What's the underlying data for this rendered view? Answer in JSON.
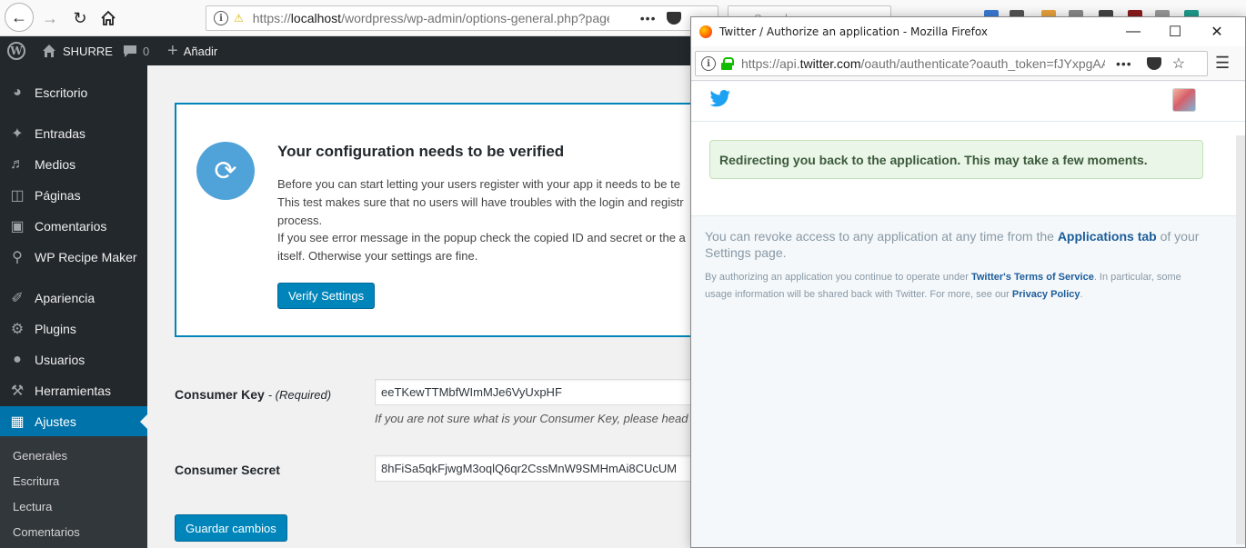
{
  "browser": {
    "url_prefix": "https://",
    "url_domain": "localhost",
    "url_path": "/wordpress/wp-admin/options-general.php?page",
    "search_placeholder": "Search",
    "dots": "•••"
  },
  "adminbar": {
    "site_name": "SHURRE",
    "comments_count": "0",
    "new_label": "Añadir"
  },
  "sidebar": {
    "items": [
      {
        "label": "Escritorio",
        "icon": "dashboard-icon"
      },
      {
        "label": "Entradas",
        "icon": "pin-icon"
      },
      {
        "label": "Medios",
        "icon": "media-icon"
      },
      {
        "label": "Páginas",
        "icon": "pages-icon"
      },
      {
        "label": "Comentarios",
        "icon": "comment-icon"
      },
      {
        "label": "WP Recipe Maker",
        "icon": "fork-knife-icon"
      },
      {
        "label": "Apariencia",
        "icon": "brush-icon"
      },
      {
        "label": "Plugins",
        "icon": "plugin-icon"
      },
      {
        "label": "Usuarios",
        "icon": "user-icon"
      },
      {
        "label": "Herramientas",
        "icon": "wrench-icon"
      },
      {
        "label": "Ajustes",
        "icon": "settings-icon"
      }
    ],
    "submenu": [
      "Generales",
      "Escritura",
      "Lectura",
      "Comentarios"
    ]
  },
  "notice": {
    "title": "Your configuration needs to be verified",
    "lines": [
      "Before you can start letting your users register with your app it needs to be te",
      "This test makes sure that no users will have troubles with the login and registr",
      "process.",
      "If you see error message in the popup check the copied ID and secret or the a",
      "itself. Otherwise your settings are fine."
    ],
    "verify_button": "Verify Settings"
  },
  "form": {
    "consumer_key_label": "Consumer Key",
    "required_text": "- (Required)",
    "consumer_key_value": "eeTKewTTMbfWImMJe6VyUxpHF",
    "consumer_key_help": "If you are not sure what is your Consumer Key, please head ov",
    "consumer_secret_label": "Consumer Secret",
    "consumer_secret_value": "8hFiSa5qkFjwgM3oqlQ6qr2CssMnW9SMHmAi8CUcUM",
    "save_button": "Guardar cambios"
  },
  "popup": {
    "title": "Twitter / Authorize an application - Mozilla Firefox",
    "url_prefix": "https://api.",
    "url_domain": "twitter.com",
    "url_path": "/oauth/authenticate?oauth_token=fJYxpgAAA",
    "dots": "•••",
    "redirect_message": "Redirecting you back to the application. This may take a few moments.",
    "revoke_before": "You can revoke access to any application at any time from the ",
    "revoke_link": "Applications tab",
    "revoke_after": " of your Settings page.",
    "fine_before": "By authorizing an application you continue to operate under ",
    "fine_link1": "Twitter's Terms of Service",
    "fine_middle": ". In particular, some usage information will be shared back with Twitter. For more, see our ",
    "fine_link2": "Privacy Policy",
    "fine_after": "."
  }
}
